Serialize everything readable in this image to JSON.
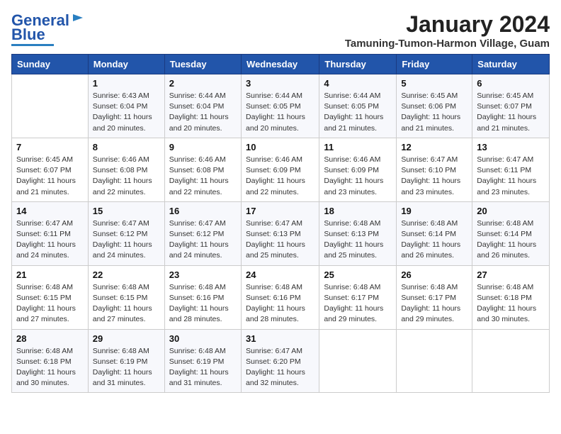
{
  "logo": {
    "line1": "General",
    "line2": "Blue"
  },
  "header": {
    "month_title": "January 2024",
    "subtitle": "Tamuning-Tumon-Harmon Village, Guam"
  },
  "days_of_week": [
    "Sunday",
    "Monday",
    "Tuesday",
    "Wednesday",
    "Thursday",
    "Friday",
    "Saturday"
  ],
  "weeks": [
    [
      {
        "day": "",
        "info": ""
      },
      {
        "day": "1",
        "info": "Sunrise: 6:43 AM\nSunset: 6:04 PM\nDaylight: 11 hours\nand 20 minutes."
      },
      {
        "day": "2",
        "info": "Sunrise: 6:44 AM\nSunset: 6:04 PM\nDaylight: 11 hours\nand 20 minutes."
      },
      {
        "day": "3",
        "info": "Sunrise: 6:44 AM\nSunset: 6:05 PM\nDaylight: 11 hours\nand 20 minutes."
      },
      {
        "day": "4",
        "info": "Sunrise: 6:44 AM\nSunset: 6:05 PM\nDaylight: 11 hours\nand 21 minutes."
      },
      {
        "day": "5",
        "info": "Sunrise: 6:45 AM\nSunset: 6:06 PM\nDaylight: 11 hours\nand 21 minutes."
      },
      {
        "day": "6",
        "info": "Sunrise: 6:45 AM\nSunset: 6:07 PM\nDaylight: 11 hours\nand 21 minutes."
      }
    ],
    [
      {
        "day": "7",
        "info": "Sunrise: 6:45 AM\nSunset: 6:07 PM\nDaylight: 11 hours\nand 21 minutes."
      },
      {
        "day": "8",
        "info": "Sunrise: 6:46 AM\nSunset: 6:08 PM\nDaylight: 11 hours\nand 22 minutes."
      },
      {
        "day": "9",
        "info": "Sunrise: 6:46 AM\nSunset: 6:08 PM\nDaylight: 11 hours\nand 22 minutes."
      },
      {
        "day": "10",
        "info": "Sunrise: 6:46 AM\nSunset: 6:09 PM\nDaylight: 11 hours\nand 22 minutes."
      },
      {
        "day": "11",
        "info": "Sunrise: 6:46 AM\nSunset: 6:09 PM\nDaylight: 11 hours\nand 23 minutes."
      },
      {
        "day": "12",
        "info": "Sunrise: 6:47 AM\nSunset: 6:10 PM\nDaylight: 11 hours\nand 23 minutes."
      },
      {
        "day": "13",
        "info": "Sunrise: 6:47 AM\nSunset: 6:11 PM\nDaylight: 11 hours\nand 23 minutes."
      }
    ],
    [
      {
        "day": "14",
        "info": "Sunrise: 6:47 AM\nSunset: 6:11 PM\nDaylight: 11 hours\nand 24 minutes."
      },
      {
        "day": "15",
        "info": "Sunrise: 6:47 AM\nSunset: 6:12 PM\nDaylight: 11 hours\nand 24 minutes."
      },
      {
        "day": "16",
        "info": "Sunrise: 6:47 AM\nSunset: 6:12 PM\nDaylight: 11 hours\nand 24 minutes."
      },
      {
        "day": "17",
        "info": "Sunrise: 6:47 AM\nSunset: 6:13 PM\nDaylight: 11 hours\nand 25 minutes."
      },
      {
        "day": "18",
        "info": "Sunrise: 6:48 AM\nSunset: 6:13 PM\nDaylight: 11 hours\nand 25 minutes."
      },
      {
        "day": "19",
        "info": "Sunrise: 6:48 AM\nSunset: 6:14 PM\nDaylight: 11 hours\nand 26 minutes."
      },
      {
        "day": "20",
        "info": "Sunrise: 6:48 AM\nSunset: 6:14 PM\nDaylight: 11 hours\nand 26 minutes."
      }
    ],
    [
      {
        "day": "21",
        "info": "Sunrise: 6:48 AM\nSunset: 6:15 PM\nDaylight: 11 hours\nand 27 minutes."
      },
      {
        "day": "22",
        "info": "Sunrise: 6:48 AM\nSunset: 6:15 PM\nDaylight: 11 hours\nand 27 minutes."
      },
      {
        "day": "23",
        "info": "Sunrise: 6:48 AM\nSunset: 6:16 PM\nDaylight: 11 hours\nand 28 minutes."
      },
      {
        "day": "24",
        "info": "Sunrise: 6:48 AM\nSunset: 6:16 PM\nDaylight: 11 hours\nand 28 minutes."
      },
      {
        "day": "25",
        "info": "Sunrise: 6:48 AM\nSunset: 6:17 PM\nDaylight: 11 hours\nand 29 minutes."
      },
      {
        "day": "26",
        "info": "Sunrise: 6:48 AM\nSunset: 6:17 PM\nDaylight: 11 hours\nand 29 minutes."
      },
      {
        "day": "27",
        "info": "Sunrise: 6:48 AM\nSunset: 6:18 PM\nDaylight: 11 hours\nand 30 minutes."
      }
    ],
    [
      {
        "day": "28",
        "info": "Sunrise: 6:48 AM\nSunset: 6:18 PM\nDaylight: 11 hours\nand 30 minutes."
      },
      {
        "day": "29",
        "info": "Sunrise: 6:48 AM\nSunset: 6:19 PM\nDaylight: 11 hours\nand 31 minutes."
      },
      {
        "day": "30",
        "info": "Sunrise: 6:48 AM\nSunset: 6:19 PM\nDaylight: 11 hours\nand 31 minutes."
      },
      {
        "day": "31",
        "info": "Sunrise: 6:47 AM\nSunset: 6:20 PM\nDaylight: 11 hours\nand 32 minutes."
      },
      {
        "day": "",
        "info": ""
      },
      {
        "day": "",
        "info": ""
      },
      {
        "day": "",
        "info": ""
      }
    ]
  ]
}
